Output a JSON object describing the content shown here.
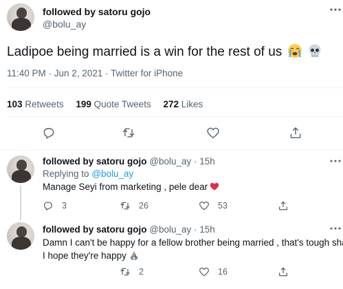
{
  "main_tweet": {
    "author_name": "followed by satoru gojo",
    "handle": "@bolu_ay",
    "text": "Ladipoe being married is a win for the rest of us",
    "emojis": [
      "loudly-crying-face",
      "skull"
    ],
    "time": "11:40 PM · Jun 2, 2021 · Twitter for iPhone",
    "retweets_count": "103",
    "retweets_label": "Retweets",
    "quotes_count": "199",
    "quotes_label": "Quote Tweets",
    "likes_count": "272",
    "likes_label": "Likes"
  },
  "replies": [
    {
      "author_name": "followed by satoru gojo",
      "handle_time": "@bolu_ay · 15h",
      "replying_prefix": "Replying to",
      "replying_handle": "@bolu_ay",
      "text": "Manage Seyi from marketing , pele dear",
      "emoji": "red-heart",
      "reply_count": "3",
      "retweet_count": "26",
      "like_count": "53"
    },
    {
      "author_name": "followed by satoru gojo",
      "handle_time": "@bolu_ay · 15h",
      "text_line1": "Damn I can't be happy for a fellow brother being married , that's tough sha",
      "text_line2": "I hope they're happy",
      "emoji": "folded-hands",
      "retweet_count": "2",
      "like_count": "16"
    }
  ],
  "colors": {
    "text": "#0f1419",
    "muted": "#536471",
    "accent": "#1d9bf0",
    "divider": "#eff3f4"
  }
}
